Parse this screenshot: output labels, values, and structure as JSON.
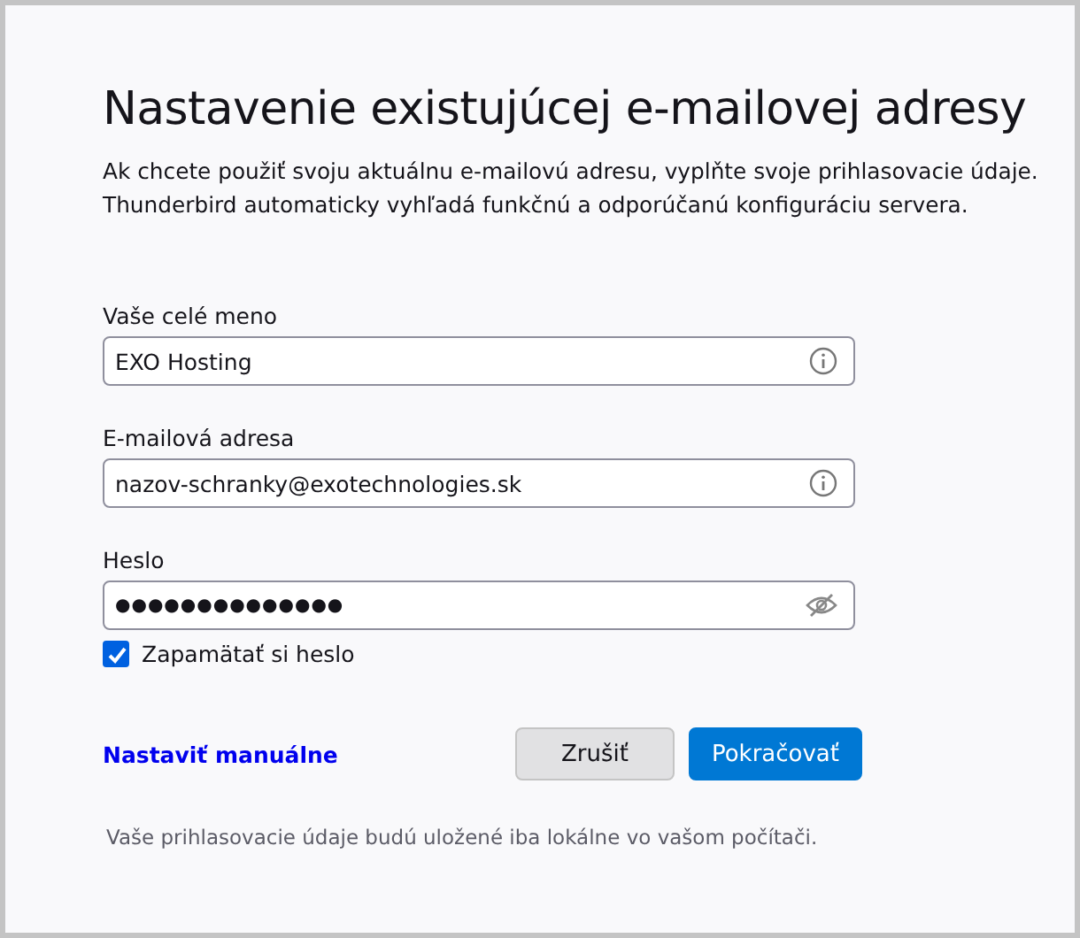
{
  "title": "Nastavenie existujúcej e-mailovej adresy",
  "description": [
    "Ak chcete použiť svoju aktuálnu e-mailovú adresu, vyplňte svoje prihlasovacie údaje.",
    "Thunderbird automaticky vyhľadá funkčnú a odporúčanú konfiguráciu servera."
  ],
  "fields": [
    {
      "label": "Vaše celé meno",
      "value": "EXO Hosting",
      "kind": "text"
    },
    {
      "label": "E-mailová adresa",
      "value": "nazov-schranky@exotechnologies.sk",
      "kind": "text"
    },
    {
      "label": "Heslo",
      "value": "●●●●●●●●●●●●●●",
      "kind": "password"
    }
  ],
  "remember": {
    "label": "Zapamätať si heslo",
    "checked": true
  },
  "manual_link": "Nastaviť manuálne",
  "buttons": [
    {
      "label": "Zrušiť",
      "kind": "secondary"
    },
    {
      "label": "Pokračovať",
      "kind": "primary"
    }
  ],
  "footer": "Vaše prihlasovacie údaje budú uložené iba lokálne vo vašom počítači."
}
